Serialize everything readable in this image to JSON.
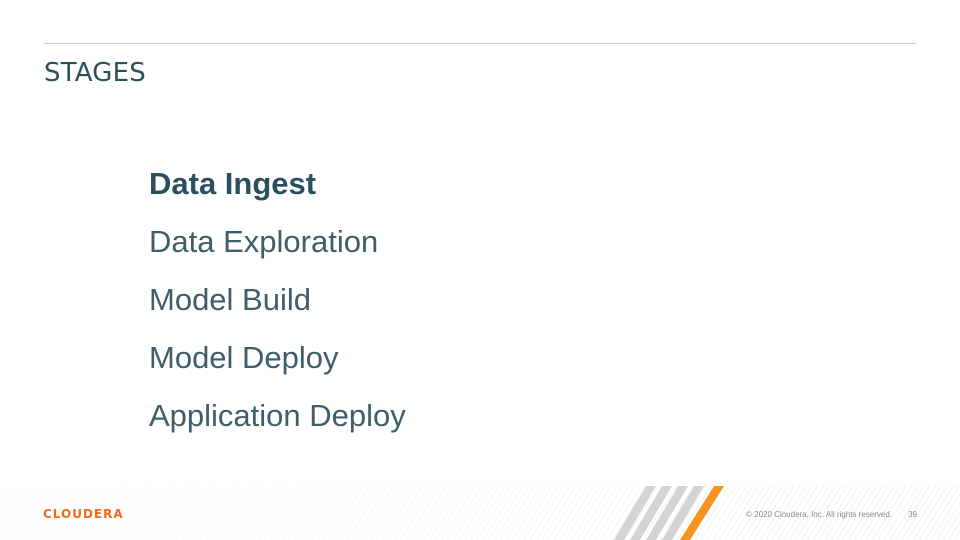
{
  "slide": {
    "title": "STAGES",
    "stages": [
      {
        "label": "Data Ingest",
        "active": true
      },
      {
        "label": "Data Exploration",
        "active": false
      },
      {
        "label": "Model Build",
        "active": false
      },
      {
        "label": "Model Deploy",
        "active": false
      },
      {
        "label": "Application Deploy",
        "active": false
      }
    ]
  },
  "footer": {
    "logo_text": "CLOUDERA",
    "copyright": "© 2020 Cloudera, Inc. All rights reserved.",
    "page_number": "39"
  },
  "colors": {
    "title": "#2c4f5e",
    "text": "#3f5e6b",
    "accent_orange": "#f26b1d",
    "stripe_gray": "#cfcfcf"
  },
  "icons": {
    "footer_graphic": "diagonal-stripes-graphic",
    "logo": "cloudera-logo"
  }
}
